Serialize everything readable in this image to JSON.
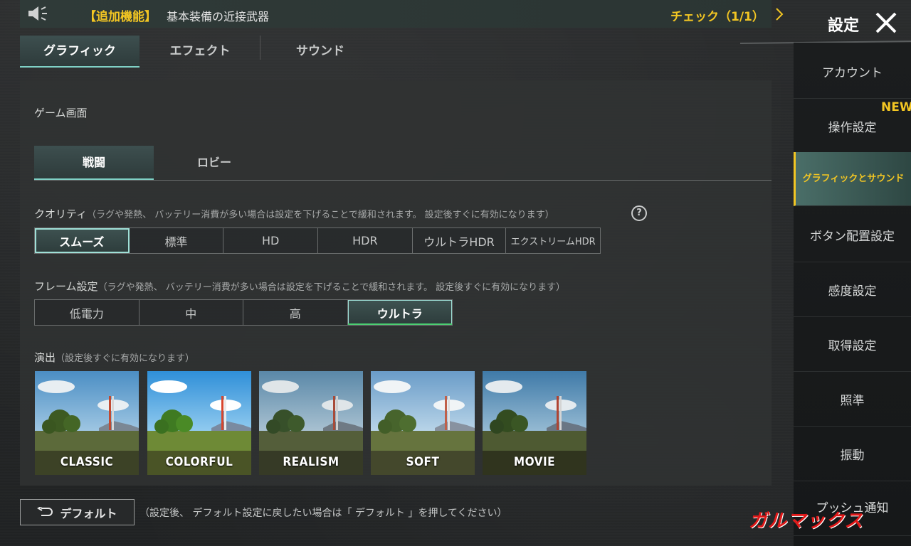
{
  "banner": {
    "bracket_label": "【追加機能】",
    "title": "基本装備の近接武器",
    "check_label": "チェック（1/1）"
  },
  "tabs": [
    {
      "label": "グラフィック",
      "active": true
    },
    {
      "label": "エフェクト",
      "active": false
    },
    {
      "label": "サウンド",
      "active": false
    }
  ],
  "game_screen": {
    "label": "ゲーム画面",
    "subtabs": [
      {
        "label": "戦闘",
        "active": true
      },
      {
        "label": "ロビー",
        "active": false
      }
    ]
  },
  "quality": {
    "label": "クオリティ",
    "note": "（ラグや発熱、 バッテリー消費が多い場合は設定を下げることで緩和されます。 設定後すぐに有効になります）",
    "options": [
      "スムーズ",
      "標準",
      "HD",
      "HDR",
      "ウルトラHDR",
      "エクストリームHDR"
    ],
    "selected": "スムーズ",
    "help": "?"
  },
  "frame": {
    "label": "フレーム設定",
    "note": "（ラグや発熱、 バッテリー消費が多い場合は設定を下げることで緩和されます。 設定後すぐに有効になります）",
    "options": [
      "低電力",
      "中",
      "高",
      "ウルトラ"
    ],
    "selected": "ウルトラ"
  },
  "effect_style": {
    "label": "演出",
    "note": "（設定後すぐに有効になります）",
    "styles": [
      "CLASSIC",
      "COLORFUL",
      "REALISM",
      "SOFT",
      "MOVIE"
    ],
    "selected": "CLASSIC"
  },
  "default_button": {
    "label": "デフォルト",
    "note": "（設定後、 デフォルト設定に戻したい場合は「 デフォルト 」を押してください）"
  },
  "sidebar": {
    "title": "設定",
    "new_badge": "NEW",
    "items": [
      {
        "label": "アカウント"
      },
      {
        "label": "操作設定"
      },
      {
        "label": "グラフィックとサウンド",
        "active": true
      },
      {
        "label": "ボタン配置設定"
      },
      {
        "label": "感度設定"
      },
      {
        "label": "取得設定"
      },
      {
        "label": "照準"
      },
      {
        "label": "振動"
      },
      {
        "label": "プッシュ通知"
      }
    ]
  },
  "watermark": "ガルマックス",
  "colors": {
    "accent_yellow": "#f3c623",
    "accent_teal": "#9fe0d7",
    "accent_green": "#4ccf72",
    "watermark_red": "#e01818"
  }
}
